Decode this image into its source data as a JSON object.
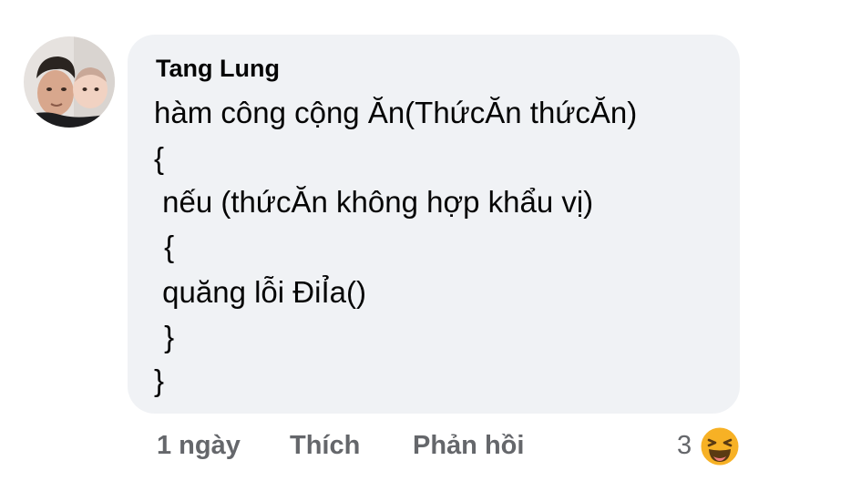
{
  "comment": {
    "author": "Tang Lung",
    "lines": [
      "hàm công cộng Ăn(ThứcĂn thứcĂn)",
      "{",
      " nếu (thứcĂn không hợp khẩu vị)",
      " {",
      " quăng lỗi ĐiỈa()",
      " }",
      "}"
    ]
  },
  "actions": {
    "time": "1 ngày",
    "like": "Thích",
    "reply": "Phản hồi"
  },
  "reactions": {
    "count": "3",
    "icon": "haha-emoji-icon"
  },
  "colors": {
    "bubble": "#f0f2f5",
    "text": "#050505",
    "meta": "#65676b",
    "emoji": "#f7b125"
  }
}
